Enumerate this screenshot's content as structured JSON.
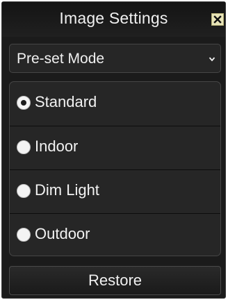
{
  "dialog": {
    "title": "Image Settings",
    "close_icon": "close-icon"
  },
  "preset": {
    "label": "Pre-set Mode",
    "chevron_icon": "chevron-down-icon"
  },
  "options": [
    {
      "label": "Standard",
      "selected": true
    },
    {
      "label": "Indoor",
      "selected": false
    },
    {
      "label": "Dim Light",
      "selected": false
    },
    {
      "label": "Outdoor",
      "selected": false
    }
  ],
  "restore_label": "Restore",
  "colors": {
    "background": "#1b1b1b",
    "panel": "#262626",
    "text": "#f0f0f0",
    "close_button": "#e8e4b8"
  }
}
